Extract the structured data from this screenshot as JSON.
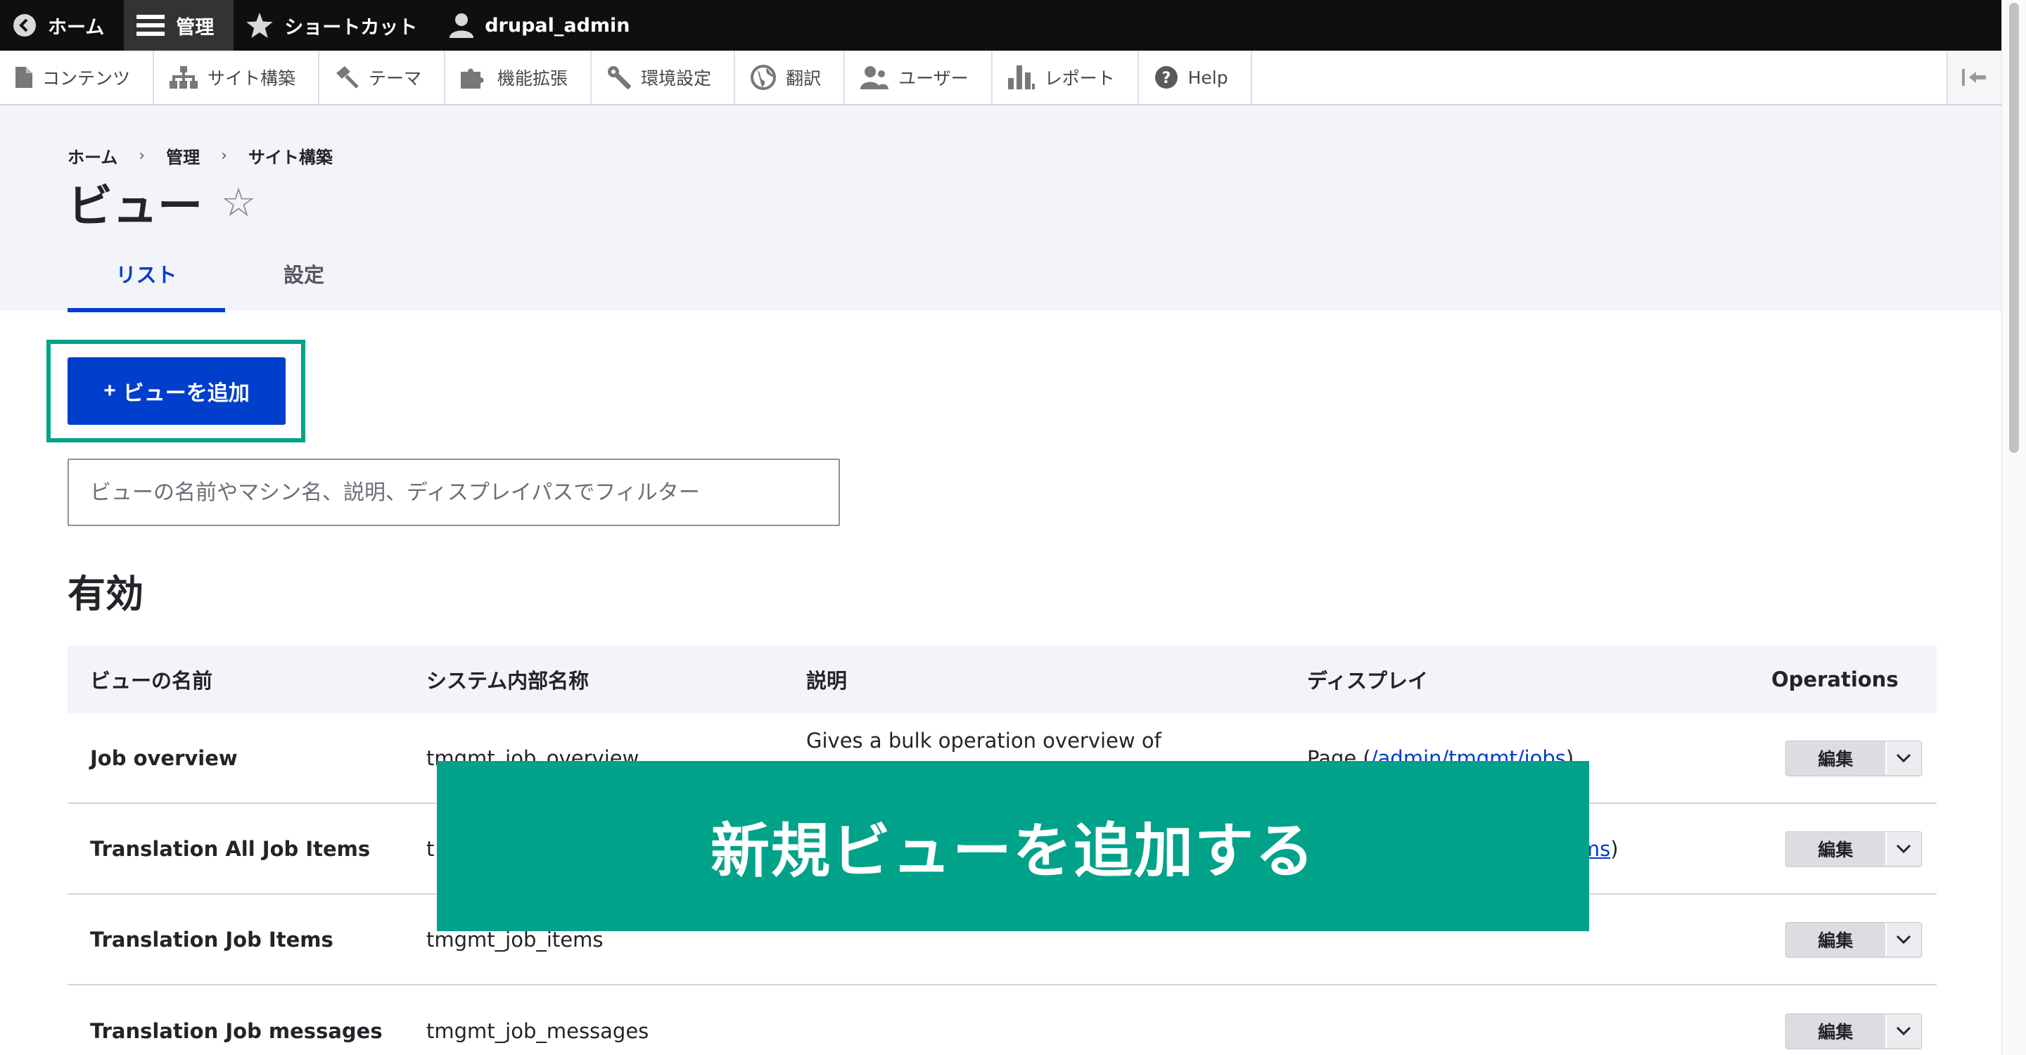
{
  "topbar": {
    "home": "ホーム",
    "manage": "管理",
    "shortcuts": "ショートカット",
    "user": "drupal_admin"
  },
  "tray": {
    "items": [
      "コンテンツ",
      "サイト構築",
      "テーマ",
      "機能拡張",
      "環境設定",
      "翻訳",
      "ユーザー",
      "レポート",
      "Help"
    ]
  },
  "breadcrumb": [
    "ホーム",
    "管理",
    "サイト構築"
  ],
  "breadcrumb_sep": "›",
  "page": {
    "title": "ビュー",
    "star": "☆"
  },
  "tabs": [
    "リスト",
    "設定"
  ],
  "add_button": {
    "plus": "+",
    "label": "ビューを追加"
  },
  "filter": {
    "placeholder": "ビューの名前やマシン名、説明、ディスプレイパスでフィルター"
  },
  "section_title": "有効",
  "table": {
    "headers": [
      "ビューの名前",
      "システム内部名称",
      "説明",
      "ディスプレイ",
      "Operations"
    ],
    "rows": [
      {
        "name": "Job overview",
        "machine": "tmgmt_job_overview",
        "desc": "Gives a bulk operation overview of",
        "display_prefix": "Page (",
        "display_link": "/admin/tmgmt/jobs",
        "display_suffix": ")",
        "edit": "編集"
      },
      {
        "name": "Translation All Job Items",
        "machine": "t",
        "desc": "",
        "display_prefix": "",
        "display_link": "ems",
        "display_suffix": ")",
        "edit": "編集"
      },
      {
        "name": "Translation Job Items",
        "machine": "tmgmt_job_items",
        "desc": "",
        "display_prefix": "",
        "display_link": "",
        "display_suffix": "",
        "edit": "編集"
      },
      {
        "name": "Translation Job messages",
        "machine": "tmgmt_job_messages",
        "desc": "",
        "display_prefix": "",
        "display_link": "",
        "display_suffix": "",
        "edit": "編集"
      }
    ]
  },
  "banner": "新規ビューを追加する",
  "colors": {
    "accent": "#003ecc",
    "highlight": "#00a28a",
    "topbar": "#0f0f0f"
  }
}
